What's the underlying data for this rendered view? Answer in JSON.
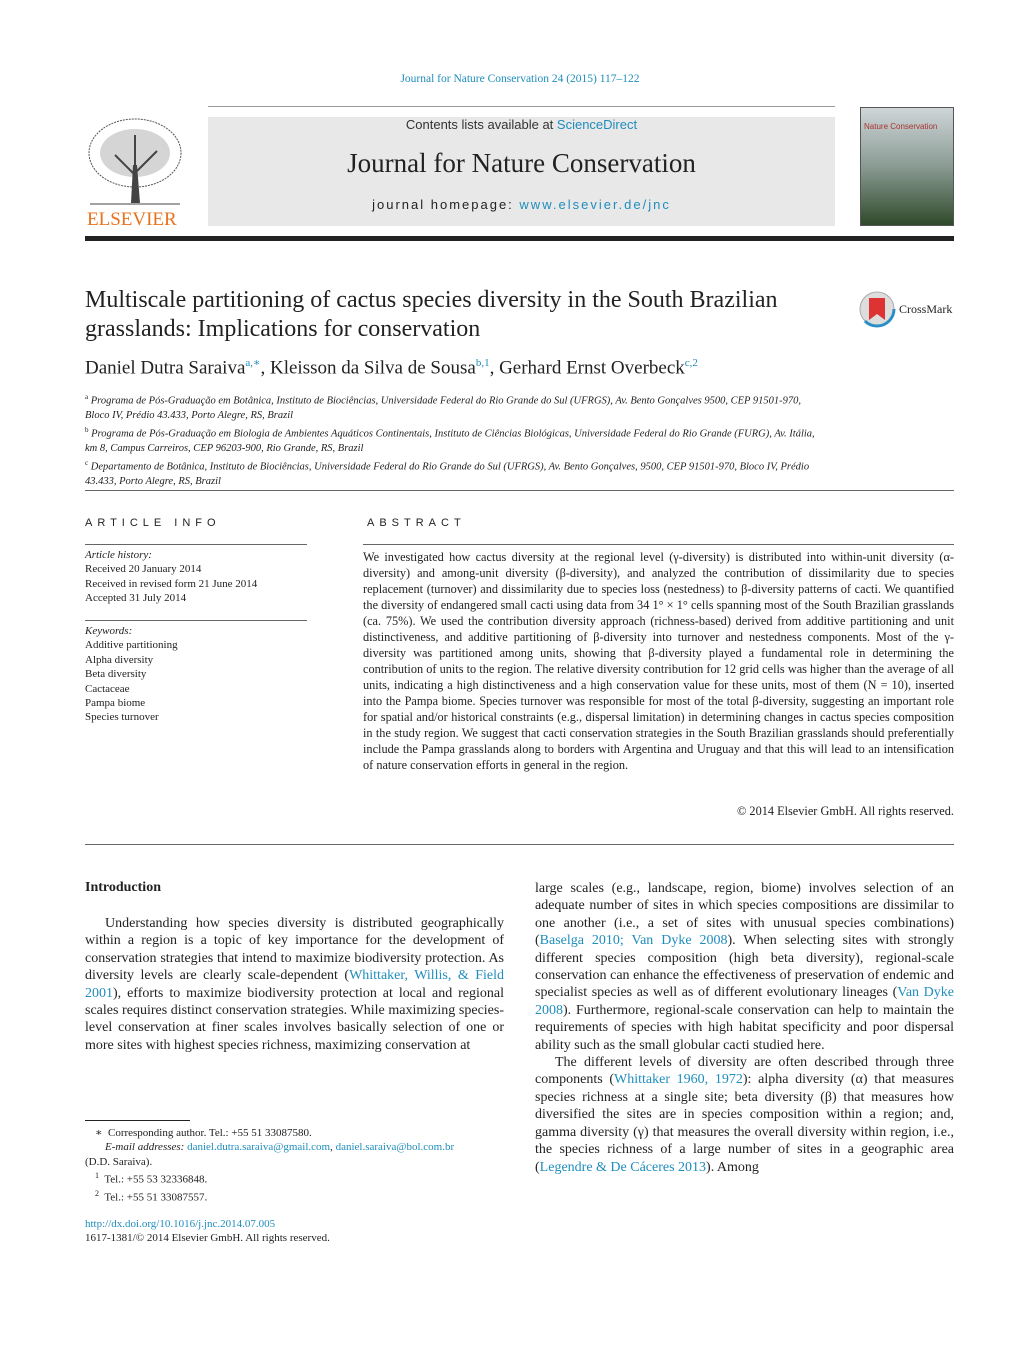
{
  "header": {
    "running_head": "Journal for Nature Conservation 24 (2015) 117–122",
    "contents_prefix": "Contents lists available at ",
    "contents_link": "ScienceDirect",
    "journal_title": "Journal for Nature Conservation",
    "homepage_prefix": "journal homepage: ",
    "homepage_link": "www.elsevier.de/jnc",
    "publisher_logo": "ELSEVIER",
    "cover_text": "Nature Conservation",
    "crossmark": "CrossMark"
  },
  "article": {
    "title": "Multiscale partitioning of cactus species diversity in the South Brazilian grasslands: Implications for conservation",
    "authors": [
      {
        "name": "Daniel Dutra Saraiva",
        "sup": "a,∗"
      },
      {
        "name": "Kleisson da Silva de Sousa",
        "sup": "b,1"
      },
      {
        "name": "Gerhard Ernst Overbeck",
        "sup": "c,2"
      }
    ],
    "affiliations": [
      {
        "mark": "a",
        "text": "Programa de Pós-Graduação em Botânica, Instituto de Biociências, Universidade Federal do Rio Grande do Sul (UFRGS), Av. Bento Gonçalves 9500, CEP 91501-970, Bloco IV, Prédio 43.433, Porto Alegre, RS, Brazil"
      },
      {
        "mark": "b",
        "text": "Programa de Pós-Graduação em Biologia de Ambientes Aquáticos Continentais, Instituto de Ciências Biológicas, Universidade Federal do Rio Grande (FURG), Av. Itália, km 8, Campus Carreiros, CEP 96203-900, Rio Grande, RS, Brazil"
      },
      {
        "mark": "c",
        "text": "Departamento de Botânica, Instituto de Biociências, Universidade Federal do Rio Grande do Sul (UFRGS), Av. Bento Gonçalves, 9500, CEP 91501-970, Bloco IV, Prédio 43.433, Porto Alegre, RS, Brazil"
      }
    ]
  },
  "info": {
    "heading": "ARTICLE INFO",
    "history_label": "Article history:",
    "history": [
      "Received 20 January 2014",
      "Received in revised form 21 June 2014",
      "Accepted 31 July 2014"
    ],
    "keywords_label": "Keywords:",
    "keywords": [
      "Additive partitioning",
      "Alpha diversity",
      "Beta diversity",
      "Cactaceae",
      "Pampa biome",
      "Species turnover"
    ]
  },
  "abstract": {
    "heading": "ABSTRACT",
    "text": "We investigated how cactus diversity at the regional level (γ-diversity) is distributed into within-unit diversity (α-diversity) and among-unit diversity (β-diversity), and analyzed the contribution of dissimilarity due to species replacement (turnover) and dissimilarity due to species loss (nestedness) to β-diversity patterns of cacti. We quantified the diversity of endangered small cacti using data from 34 1° × 1° cells spanning most of the South Brazilian grasslands (ca. 75%). We used the contribution diversity approach (richness-based) derived from additive partitioning and unit distinctiveness, and additive partitioning of β-diversity into turnover and nestedness components. Most of the γ-diversity was partitioned among units, showing that β-diversity played a fundamental role in determining the contribution of units to the region. The relative diversity contribution for 12 grid cells was higher than the average of all units, indicating a high distinctiveness and a high conservation value for these units, most of them (N = 10), inserted into the Pampa biome. Species turnover was responsible for most of the total β-diversity, suggesting an important role for spatial and/or historical constraints (e.g., dispersal limitation) in determining changes in cactus species composition in the study region. We suggest that cacti conservation strategies in the South Brazilian grasslands should preferentially include the Pampa grasslands along to borders with Argentina and Uruguay and that this will lead to an intensification of nature conservation efforts in general in the region.",
    "copyright": "© 2014 Elsevier GmbH. All rights reserved."
  },
  "body": {
    "intro_heading": "Introduction",
    "left": [
      {
        "parts": [
          "Understanding how species diversity is distributed geographically within a region is a topic of key importance for the development of conservation strategies that intend to maximize biodiversity protection. As diversity levels are clearly scale-dependent (",
          {
            "link": "Whittaker, Willis, & Field 2001"
          },
          "), efforts to maximize biodiversity protection at local and regional scales requires distinct conservation strategies. While maximizing species-level conservation at finer scales involves basically selection of one or more sites with highest species richness, maximizing conservation at"
        ]
      }
    ],
    "right": [
      {
        "parts": [
          "large scales (e.g., landscape, region, biome) involves selection of an adequate number of sites in which species compositions are dissimilar to one another (i.e., a set of sites with unusual species combinations) (",
          {
            "link": "Baselga 2010; Van Dyke 2008"
          },
          "). When selecting sites with strongly different species composition (high beta diversity), regional-scale conservation can enhance the effectiveness of preservation of endemic and specialist species as well as of different evolutionary lineages (",
          {
            "link": "Van Dyke 2008"
          },
          "). Furthermore, regional-scale conservation can help to maintain the requirements of species with high habitat specificity and poor dispersal ability such as the small globular cacti studied here."
        ]
      },
      {
        "parts": [
          "The different levels of diversity are often described through three components (",
          {
            "link": "Whittaker 1960, 1972"
          },
          "): alpha diversity (α) that measures species richness at a single site; beta diversity (β) that measures how diversified the sites are in species composition within a region; and, gamma diversity (γ) that measures the overall diversity within region, i.e., the species richness of a large number of sites in a geographic area (",
          {
            "link": "Legendre & De Cáceres 2013"
          },
          "). Among"
        ]
      }
    ]
  },
  "footnotes": {
    "corresponding": "Corresponding author. Tel.: +55 51 33087580.",
    "email_label": "E-mail addresses:",
    "emails": [
      "daniel.dutra.saraiva@gmail.com",
      "daniel.saraiva@bol.com.br"
    ],
    "email_owner": "(D.D. Saraiva).",
    "notes": [
      {
        "mark": "1",
        "text": "Tel.: +55 53 32336848."
      },
      {
        "mark": "2",
        "text": "Tel.: +55 51 33087557."
      }
    ],
    "doi": "http://dx.doi.org/10.1016/j.jnc.2014.07.005",
    "issn": "1617-1381/© 2014 Elsevier GmbH. All rights reserved."
  },
  "colors": {
    "link": "#1f8dbd",
    "elsevier_orange": "#e9711c"
  }
}
